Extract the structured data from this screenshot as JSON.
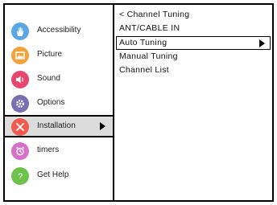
{
  "left_menu": {
    "items": [
      {
        "label": "Accessibility",
        "icon": "hand-icon",
        "color": "#5aa7e6"
      },
      {
        "label": "Picture",
        "icon": "picture-icon",
        "color": "#f4a23a"
      },
      {
        "label": "Sound",
        "icon": "speaker-icon",
        "color": "#e8456f"
      },
      {
        "label": "Options",
        "icon": "gear-icon",
        "color": "#7a6fb0"
      },
      {
        "label": "Installation",
        "icon": "tools-icon",
        "color": "#f05a4f",
        "selected": true
      },
      {
        "label": "timers",
        "icon": "alarm-clock-icon",
        "color": "#d86fc8"
      },
      {
        "label": "Get Help",
        "icon": "question-icon",
        "color": "#6cc24a"
      }
    ]
  },
  "right_menu": {
    "header": "< Channel  Tuning",
    "subheader": "ANT/CABLE IN",
    "items": [
      {
        "label": "Auto  Tuning",
        "selected": true
      },
      {
        "label": "Manual Tuning"
      },
      {
        "label": "Channel List"
      }
    ]
  }
}
